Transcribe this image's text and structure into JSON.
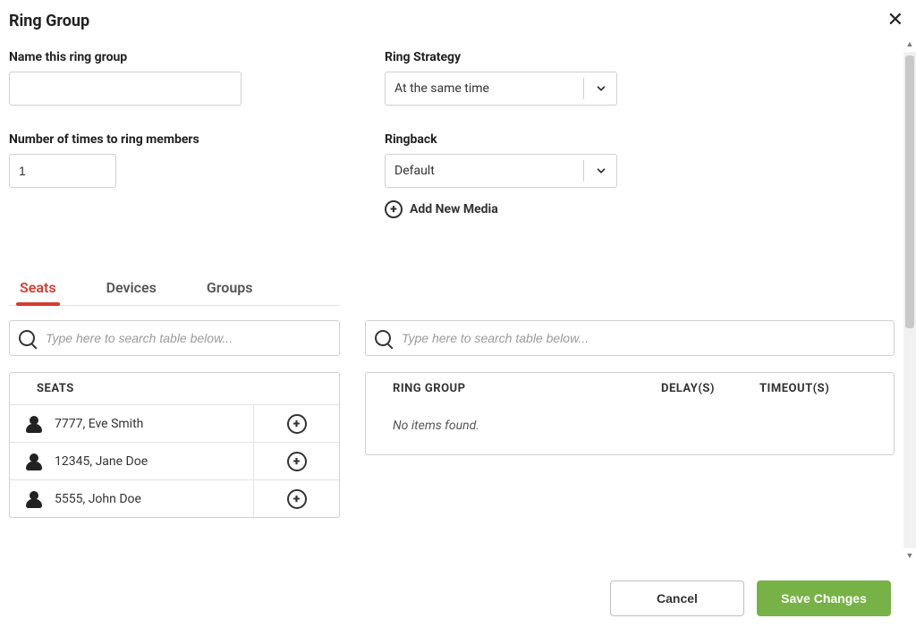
{
  "modal": {
    "title": "Ring Group"
  },
  "fields": {
    "name_label": "Name this ring group",
    "name_value": "",
    "ring_strategy_label": "Ring Strategy",
    "ring_strategy_value": "At the same time",
    "ring_times_label": "Number of times to ring members",
    "ring_times_value": "1",
    "ringback_label": "Ringback",
    "ringback_value": "Default",
    "add_media": "Add New Media"
  },
  "tabs": {
    "items": [
      {
        "label": "Seats",
        "active": true
      },
      {
        "label": "Devices",
        "active": false
      },
      {
        "label": "Groups",
        "active": false
      }
    ]
  },
  "search": {
    "placeholder_left": "Type here to search table below...",
    "placeholder_right": "Type here to search table below..."
  },
  "left_table": {
    "header": "SEATS",
    "rows": [
      {
        "label": "7777, Eve Smith"
      },
      {
        "label": "12345, Jane Doe"
      },
      {
        "label": "5555, John Doe"
      }
    ]
  },
  "right_table": {
    "headers": {
      "c1": "RING GROUP",
      "c2": "DELAY(S)",
      "c3": "TIMEOUT(S)"
    },
    "empty": "No items found."
  },
  "footer": {
    "cancel": "Cancel",
    "save": "Save Changes"
  }
}
